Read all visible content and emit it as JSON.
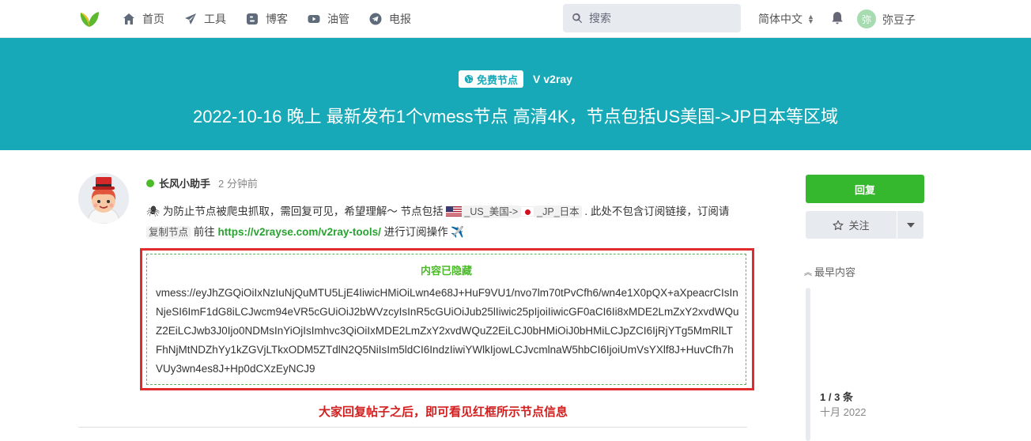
{
  "header": {
    "nav": [
      {
        "label": "首页",
        "icon": "home-icon"
      },
      {
        "label": "工具",
        "icon": "paper-plane-icon"
      },
      {
        "label": "博客",
        "icon": "blogger-icon"
      },
      {
        "label": "油管",
        "icon": "youtube-icon"
      },
      {
        "label": "电报",
        "icon": "telegram-icon"
      }
    ],
    "search_placeholder": "搜索",
    "language": "简体中文",
    "user_initial": "弥",
    "username": "弥豆子"
  },
  "hero": {
    "tag_primary": "免费节点",
    "tag_secondary": "v2ray",
    "title": "2022-10-16 晚上 最新发布1个vmess节点 高清4K，节点包括US美国->JP日本等区域"
  },
  "post": {
    "author": "长风小助手",
    "time": "2 分钟前",
    "text_1": "为防止节点被爬虫抓取，需回复可见，希望理解～ 节点包括",
    "code_us": "_US_美国->",
    "code_jp": "_JP_日本",
    "text_2": ". 此处不包含订阅链接，订阅请",
    "code_sub": "复制节点",
    "text_3": "前往",
    "link": "https://v2rayse.com/v2ray-tools/",
    "text_4": "进行订阅操作",
    "hidden_label": "内容已隐藏",
    "vmess": "vmess://eyJhZGQiOiIxNzIuNjQuMTU5LjE4IiwicHMiOiLwn4e68J+HuF9VU1/nvo7lm70tPvCfh6/wn4e1X0pQX+aXpeacrCIsInNjeSI6ImF1dG8iLCJwcm94eVR5cGUiOiJ2bWVzcyIsInR5cGUiOiJub25lIiwic25pIjoiIiwicGF0aCI6Ii8xMDE2LmZxY2xvdWQuZ2EiLCJwb3J0Ijo0NDMsInYiOjIsImhvc3QiOiIxMDE2LmZxY2xvdWQuZ2EiLCJ0bHMiOiJ0bHMiLCJpZCI6IjRjYTg5MmRlLTFhNjMtNDZhYy1kZGVjLTkxODM5ZTdlN2Q5NiIsIm5ldCI6IndzIiwiYWlkIjowLCJvcmlnaW5hbCI6IjoiUmVsYXlf8J+HuvCfh7hVUy3wn4es8J+Hp0dCXzEyNCJ9",
    "notice": "大家回复帖子之后，即可看见红框所示节点信息"
  },
  "sidebar": {
    "reply": "回复",
    "follow": "关注",
    "earliest": "最早内容",
    "count": "1 / 3 条",
    "date": "十月 2022"
  },
  "colors": {
    "hero": "#17a9b7",
    "reply": "#35b82d",
    "highlight": "#e02c2c"
  }
}
